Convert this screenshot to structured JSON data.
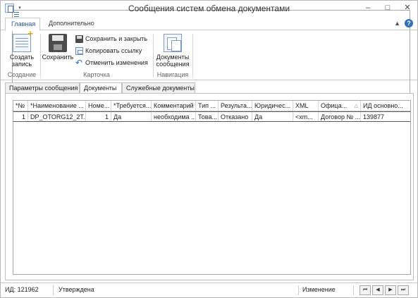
{
  "window": {
    "title": "Сообщения систем обмена документами",
    "controls": [
      "–",
      "□",
      "✕"
    ]
  },
  "ribbon": {
    "tabs": [
      "Главная",
      "Дополнительно"
    ],
    "groups": {
      "create": {
        "label": "Создание",
        "create_button": "Создать\nзапись"
      },
      "card": {
        "label": "Карточка",
        "save_button": "Сохранить",
        "save_close": "Сохранить и закрыть",
        "copy_link": "Копировать ссылку",
        "undo_changes": "Отменить изменения"
      },
      "navigation": {
        "label": "Навигация",
        "docs_button": "Документы\nсообщения"
      }
    }
  },
  "doc_tabs": [
    "Параметры сообщения",
    "Документы",
    "Служебные документы"
  ],
  "grid": {
    "columns": [
      "*№",
      "*Наименование ...",
      "Номе...",
      "*Требуется...",
      "Комментарий",
      "Тип ...",
      "Результа...",
      "Юридичес...",
      "XML",
      "Офица...",
      "ИД основно..."
    ],
    "rows": [
      {
        "marker": "I",
        "cells": [
          "1",
          "DP_OTORG12_2T...",
          "1",
          "Да",
          "необходима ...",
          "Това...",
          "Отказано",
          "Да",
          "<xm...",
          "Договор № ...",
          "139877"
        ]
      }
    ]
  },
  "status": {
    "id": "ИД: 121962",
    "state": "Утверждена",
    "mode": "Изменение",
    "nav": [
      "⏮",
      "◀",
      "▶",
      "⏭"
    ]
  }
}
